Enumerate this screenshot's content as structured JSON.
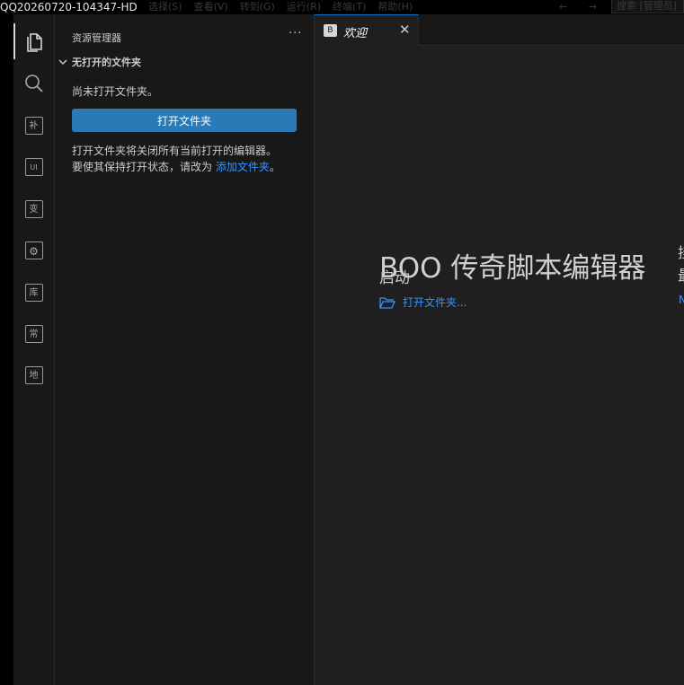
{
  "window_title": "QQ20260720-104347-HD",
  "menu": [
    "选择(S)",
    "查看(V)",
    "转到(G)",
    "运行(R)",
    "终端(T)",
    "帮助(H)"
  ],
  "nav_arrows": "← →",
  "search_box": "搜索 [管理员]",
  "activity_bar": {
    "items": [
      {
        "icon": "files-icon",
        "label": ""
      },
      {
        "icon": "search-icon",
        "label": ""
      },
      {
        "icon": "box-icon",
        "label": "补"
      },
      {
        "icon": "box-icon",
        "label": "UI"
      },
      {
        "icon": "box-icon",
        "label": "变"
      },
      {
        "icon": "gear-icon",
        "label": "⚙"
      },
      {
        "icon": "box-icon",
        "label": "库"
      },
      {
        "icon": "box-icon",
        "label": "常"
      },
      {
        "icon": "box-icon",
        "label": "地"
      }
    ]
  },
  "sidebar": {
    "title": "资源管理器",
    "more": "···",
    "section_title": "无打开的文件夹",
    "no_folder_msg": "尚未打开文件夹。",
    "open_button": "打开文件夹",
    "desc_line1": "打开文件夹将关闭所有当前打开的编辑器。",
    "desc_line2_prefix": "要使其保持打开状态，请改为 ",
    "desc_line2_link": "添加文件夹",
    "desc_line2_suffix": "。"
  },
  "editor": {
    "tab": {
      "icon_text": "B",
      "label": "欢迎",
      "close": "✕"
    },
    "welcome_title": "BOO 传奇脚本编辑器",
    "start_heading": "启动",
    "open_folder_link": "打开文件夹...",
    "edge_text": [
      "挂",
      "最",
      "N"
    ]
  },
  "colors": {
    "accent": "#2b79b5",
    "link": "#3794ff",
    "background": "#1f1f1f",
    "sidebar_bg": "#181818"
  }
}
